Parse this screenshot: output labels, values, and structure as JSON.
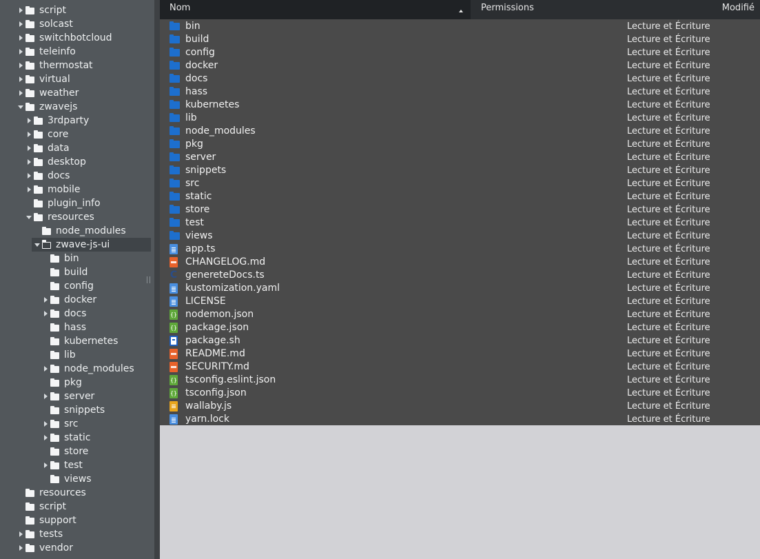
{
  "tree": [
    {
      "label": "script",
      "indent": 0,
      "toggle": "right",
      "folder": "closed"
    },
    {
      "label": "solcast",
      "indent": 0,
      "toggle": "right",
      "folder": "closed"
    },
    {
      "label": "switchbotcloud",
      "indent": 0,
      "toggle": "right",
      "folder": "closed"
    },
    {
      "label": "teleinfo",
      "indent": 0,
      "toggle": "right",
      "folder": "closed"
    },
    {
      "label": "thermostat",
      "indent": 0,
      "toggle": "right",
      "folder": "closed"
    },
    {
      "label": "virtual",
      "indent": 0,
      "toggle": "right",
      "folder": "closed"
    },
    {
      "label": "weather",
      "indent": 0,
      "toggle": "right",
      "folder": "closed"
    },
    {
      "label": "zwavejs",
      "indent": 0,
      "toggle": "down",
      "folder": "closed"
    },
    {
      "label": "3rdparty",
      "indent": 1,
      "toggle": "right",
      "folder": "closed"
    },
    {
      "label": "core",
      "indent": 1,
      "toggle": "right",
      "folder": "closed"
    },
    {
      "label": "data",
      "indent": 1,
      "toggle": "right",
      "folder": "closed"
    },
    {
      "label": "desktop",
      "indent": 1,
      "toggle": "right",
      "folder": "closed"
    },
    {
      "label": "docs",
      "indent": 1,
      "toggle": "right",
      "folder": "closed"
    },
    {
      "label": "mobile",
      "indent": 1,
      "toggle": "right",
      "folder": "closed"
    },
    {
      "label": "plugin_info",
      "indent": 1,
      "toggle": "none",
      "folder": "closed"
    },
    {
      "label": "resources",
      "indent": 1,
      "toggle": "down",
      "folder": "closed"
    },
    {
      "label": "node_modules",
      "indent": 2,
      "toggle": "none",
      "folder": "closed"
    },
    {
      "label": "zwave-js-ui",
      "indent": 2,
      "toggle": "down",
      "folder": "open",
      "selected": true
    },
    {
      "label": "bin",
      "indent": 3,
      "toggle": "none",
      "folder": "closed"
    },
    {
      "label": "build",
      "indent": 3,
      "toggle": "none",
      "folder": "closed"
    },
    {
      "label": "config",
      "indent": 3,
      "toggle": "none",
      "folder": "closed"
    },
    {
      "label": "docker",
      "indent": 3,
      "toggle": "right",
      "folder": "closed"
    },
    {
      "label": "docs",
      "indent": 3,
      "toggle": "right",
      "folder": "closed"
    },
    {
      "label": "hass",
      "indent": 3,
      "toggle": "none",
      "folder": "closed"
    },
    {
      "label": "kubernetes",
      "indent": 3,
      "toggle": "none",
      "folder": "closed"
    },
    {
      "label": "lib",
      "indent": 3,
      "toggle": "none",
      "folder": "closed"
    },
    {
      "label": "node_modules",
      "indent": 3,
      "toggle": "right",
      "folder": "closed"
    },
    {
      "label": "pkg",
      "indent": 3,
      "toggle": "none",
      "folder": "closed"
    },
    {
      "label": "server",
      "indent": 3,
      "toggle": "right",
      "folder": "closed"
    },
    {
      "label": "snippets",
      "indent": 3,
      "toggle": "none",
      "folder": "closed"
    },
    {
      "label": "src",
      "indent": 3,
      "toggle": "right",
      "folder": "closed"
    },
    {
      "label": "static",
      "indent": 3,
      "toggle": "right",
      "folder": "closed"
    },
    {
      "label": "store",
      "indent": 3,
      "toggle": "none",
      "folder": "closed"
    },
    {
      "label": "test",
      "indent": 3,
      "toggle": "right",
      "folder": "closed"
    },
    {
      "label": "views",
      "indent": 3,
      "toggle": "none",
      "folder": "closed"
    },
    {
      "label": "resources",
      "indent": 0,
      "toggle": "none",
      "folder": "closed"
    },
    {
      "label": "script",
      "indent": 0,
      "toggle": "none",
      "folder": "closed"
    },
    {
      "label": "support",
      "indent": 0,
      "toggle": "none",
      "folder": "closed"
    },
    {
      "label": "tests",
      "indent": 0,
      "toggle": "right",
      "folder": "closed"
    },
    {
      "label": "vendor",
      "indent": 0,
      "toggle": "right",
      "folder": "closed"
    }
  ],
  "columns": {
    "name": "Nom",
    "permissions": "Permissions",
    "modified": "Modifié"
  },
  "files": [
    {
      "name": "bin",
      "type": "folder",
      "perm": "Lecture et Écriture"
    },
    {
      "name": "build",
      "type": "folder",
      "perm": "Lecture et Écriture"
    },
    {
      "name": "config",
      "type": "folder",
      "perm": "Lecture et Écriture"
    },
    {
      "name": "docker",
      "type": "folder",
      "perm": "Lecture et Écriture"
    },
    {
      "name": "docs",
      "type": "folder",
      "perm": "Lecture et Écriture"
    },
    {
      "name": "hass",
      "type": "folder",
      "perm": "Lecture et Écriture"
    },
    {
      "name": "kubernetes",
      "type": "folder",
      "perm": "Lecture et Écriture"
    },
    {
      "name": "lib",
      "type": "folder",
      "perm": "Lecture et Écriture"
    },
    {
      "name": "node_modules",
      "type": "folder",
      "perm": "Lecture et Écriture"
    },
    {
      "name": "pkg",
      "type": "folder",
      "perm": "Lecture et Écriture"
    },
    {
      "name": "server",
      "type": "folder",
      "perm": "Lecture et Écriture"
    },
    {
      "name": "snippets",
      "type": "folder",
      "perm": "Lecture et Écriture"
    },
    {
      "name": "src",
      "type": "folder",
      "perm": "Lecture et Écriture"
    },
    {
      "name": "static",
      "type": "folder",
      "perm": "Lecture et Écriture"
    },
    {
      "name": "store",
      "type": "folder",
      "perm": "Lecture et Écriture"
    },
    {
      "name": "test",
      "type": "folder",
      "perm": "Lecture et Écriture"
    },
    {
      "name": "views",
      "type": "folder",
      "perm": "Lecture et Écriture"
    },
    {
      "name": "app.ts",
      "type": "ts",
      "perm": "Lecture et Écriture"
    },
    {
      "name": "CHANGELOG.md",
      "type": "md",
      "perm": "Lecture et Écriture"
    },
    {
      "name": "genereteDocs.ts",
      "type": "c",
      "perm": "Lecture et Écriture"
    },
    {
      "name": "kustomization.yaml",
      "type": "txt",
      "perm": "Lecture et Écriture"
    },
    {
      "name": "LICENSE",
      "type": "txt",
      "perm": "Lecture et Écriture"
    },
    {
      "name": "nodemon.json",
      "type": "json",
      "perm": "Lecture et Écriture"
    },
    {
      "name": "package.json",
      "type": "json",
      "perm": "Lecture et Écriture"
    },
    {
      "name": "package.sh",
      "type": "sh",
      "perm": "Lecture et Écriture"
    },
    {
      "name": "README.md",
      "type": "md",
      "perm": "Lecture et Écriture"
    },
    {
      "name": "SECURITY.md",
      "type": "md",
      "perm": "Lecture et Écriture"
    },
    {
      "name": "tsconfig.eslint.json",
      "type": "json",
      "perm": "Lecture et Écriture"
    },
    {
      "name": "tsconfig.json",
      "type": "json",
      "perm": "Lecture et Écriture"
    },
    {
      "name": "wallaby.js",
      "type": "js",
      "perm": "Lecture et Écriture"
    },
    {
      "name": "yarn.lock",
      "type": "txt",
      "perm": "Lecture et Écriture"
    }
  ]
}
